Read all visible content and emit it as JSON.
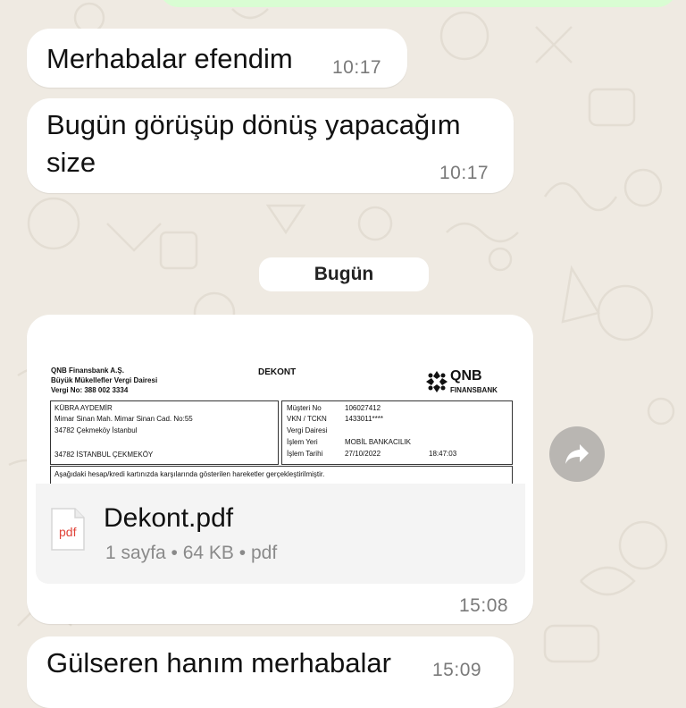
{
  "messages": [
    {
      "text": "Merhabalar efendim",
      "time": "10:17"
    },
    {
      "text_line1": "Bugün görüşüp dönüş yapacağım",
      "text_line2": "size",
      "time": "10:17"
    }
  ],
  "date_divider": "Bugün",
  "document_message": {
    "preview": {
      "bank_name": "QNB Finansbank A.Ş.",
      "tax_office": "Büyük Mükellefler Vergi Dairesi",
      "tax_no": "Vergi No: 388 002 3334",
      "doc_title": "DEKONT",
      "logo_qnb": "QNB",
      "logo_finansbank": "FINANSBANK",
      "customer_name": "KÜBRA AYDEMİR",
      "address_line1": "Mimar Sinan Mah. Mimar Sinan Cad. No:55",
      "address_line2": "34782 Çekmeköy İstanbul",
      "address_line3": "34782  İSTANBUL ÇEKMEKÖY",
      "field_labels": [
        "Müşteri No",
        "VKN / TCKN",
        "Vergi Dairesi",
        "İşlem Yeri",
        "İşlem Tarihi"
      ],
      "field_values": [
        "106027412",
        "1433011****",
        "",
        "MOBİL BANKACILIK",
        "27/10/2022"
      ],
      "time_value": "18:47:03",
      "footer_text": "Aşağıdaki hesap/kredi kartınızda karşılarında gösterilen hareketler gerçekleştirilmiştir."
    },
    "file": {
      "icon_label": "pdf",
      "name": "Dekont.pdf",
      "meta": "1 sayfa • 64 KB • pdf"
    },
    "time": "15:08"
  },
  "last_message": {
    "text": "Gülseren hanım merhabalar",
    "time": "15:09"
  },
  "colors": {
    "chat_background": "#efeae2",
    "incoming_bubble": "#ffffff",
    "outgoing_bubble": "#d9fdd3",
    "pdf_red": "#e0443a",
    "forward_button": "#b9b6b2"
  },
  "icons": {
    "forward": "forward-arrow-icon",
    "file": "pdf-file-icon",
    "logo": "qnb-logo-icon"
  }
}
